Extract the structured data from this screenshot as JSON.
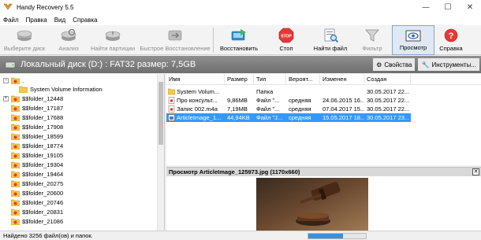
{
  "window": {
    "title": "Handy Recovery 5.5"
  },
  "menu": [
    "Файл",
    "Правка",
    "Вид",
    "Справка"
  ],
  "toolbar": [
    {
      "label": "Выберите диск",
      "icon": "disk-icon",
      "disabled": true,
      "pressed": false
    },
    {
      "label": "Анализ",
      "icon": "analyze-icon",
      "disabled": true,
      "pressed": false
    },
    {
      "label": "Найти партиции",
      "icon": "find-partitions-icon",
      "disabled": true,
      "pressed": false
    },
    {
      "label": "Быстрое Восстановление",
      "icon": "quick-recovery-icon",
      "disabled": true,
      "pressed": false
    },
    {
      "label": "Восстановить",
      "icon": "recover-icon",
      "disabled": false,
      "pressed": false
    },
    {
      "label": "Стоп",
      "icon": "stop-icon",
      "disabled": false,
      "pressed": false
    },
    {
      "label": "Найти файл",
      "icon": "find-file-icon",
      "disabled": false,
      "pressed": false
    },
    {
      "label": "Фильтр",
      "icon": "filter-icon",
      "disabled": true,
      "pressed": false
    },
    {
      "label": "Просмотр",
      "icon": "preview-icon",
      "disabled": false,
      "pressed": true
    },
    {
      "label": "Справка",
      "icon": "help-icon",
      "disabled": false,
      "pressed": false
    }
  ],
  "pathbar": {
    "text": "Локальный диск (D:) : FAT32 размер: 7,5GB",
    "properties": "Свойства",
    "tools": "Инструменты..."
  },
  "tree": {
    "root": ".",
    "children": [
      {
        "label": "System Volume Information",
        "expandable": false
      },
      {
        "label": "$$folder_12448",
        "expandable": true
      },
      {
        "label": "$$folder_17187",
        "expandable": false
      },
      {
        "label": "$$folder_17688",
        "expandable": false
      },
      {
        "label": "$$folder_17908",
        "expandable": false
      },
      {
        "label": "$$folder_18599",
        "expandable": false
      },
      {
        "label": "$$folder_18774",
        "expandable": false
      },
      {
        "label": "$$folder_19105",
        "expandable": false
      },
      {
        "label": "$$folder_19304",
        "expandable": false
      },
      {
        "label": "$$folder_19464",
        "expandable": false
      },
      {
        "label": "$$folder_20275",
        "expandable": false
      },
      {
        "label": "$$folder_20600",
        "expandable": false
      },
      {
        "label": "$$folder_20746",
        "expandable": false
      },
      {
        "label": "$$folder_20831",
        "expandable": false
      },
      {
        "label": "$$folder_21086",
        "expandable": false
      }
    ]
  },
  "filelist": {
    "columns": [
      "Имя",
      "Размер",
      "Тип",
      "Вероят...",
      "Изменен",
      "Создан"
    ],
    "rows": [
      {
        "name": "System Volum...",
        "size": "",
        "type": "Папка",
        "prob": "",
        "modified": "",
        "created": "30.05.2017 22...",
        "selected": false,
        "icon": "folder"
      },
      {
        "name": "Про консульт...",
        "size": "9,86MB",
        "type": "Файл \"...",
        "prob": "средняя",
        "modified": "24.06.2015 16...",
        "created": "30.05.2017 22...",
        "selected": false,
        "icon": "doc"
      },
      {
        "name": "Запис 002.m4a",
        "size": "7,19MB",
        "type": "Файл \"...",
        "prob": "средняя",
        "modified": "07.04.2017 15...",
        "created": "30.05.2017 22...",
        "selected": false,
        "icon": "doc"
      },
      {
        "name": "ArticleImage_1...",
        "size": "44,94KB",
        "type": "Файл \"J...",
        "prob": "средняя",
        "modified": "15.05.2017 18...",
        "created": "30.05.2017 23...",
        "selected": true,
        "icon": "image"
      }
    ]
  },
  "preview": {
    "title": "Просмотр ArticleImage_125973.jpg (1170x660)",
    "close": "✕"
  },
  "status": {
    "text": "Найдено 3256 файл(ов) и папок.",
    "progress": 0.6
  },
  "colors": {
    "selection": "#3399ff",
    "pathbar": "#7a7a7a",
    "folder": "#f2c94c"
  }
}
